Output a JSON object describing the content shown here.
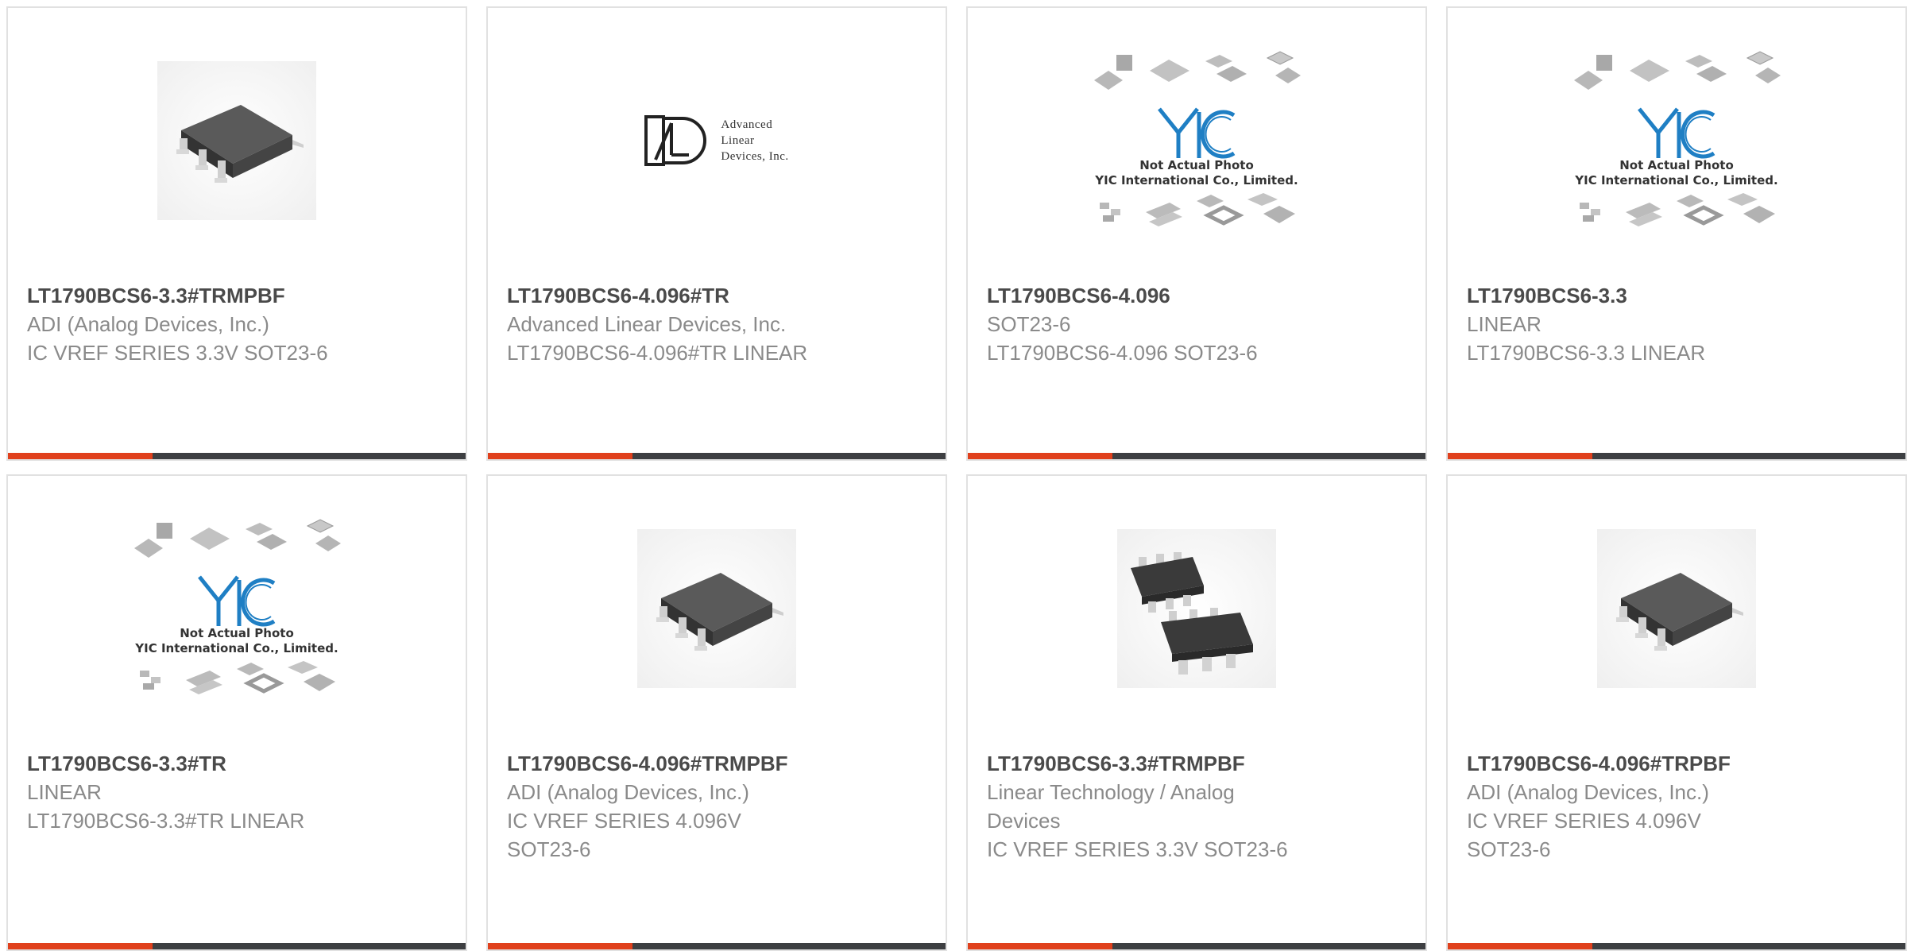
{
  "products": [
    {
      "part": "LT1790BCS6-3.3#TRMPBF",
      "lines": [
        "ADI (Analog Devices, Inc.)",
        "IC VREF SERIES 3.3V SOT23-6"
      ],
      "image": "sot23-chip"
    },
    {
      "part": "LT1790BCS6-4.096#TR",
      "lines": [
        "Advanced Linear Devices, Inc.",
        "LT1790BCS6-4.096#TR LINEAR"
      ],
      "image": "ald-logo"
    },
    {
      "part": "LT1790BCS6-4.096",
      "lines": [
        "SOT23-6",
        "LT1790BCS6-4.096 SOT23-6"
      ],
      "image": "yic-placeholder"
    },
    {
      "part": "LT1790BCS6-3.3",
      "lines": [
        "LINEAR",
        "LT1790BCS6-3.3 LINEAR"
      ],
      "image": "yic-placeholder"
    },
    {
      "part": "LT1790BCS6-3.3#TR",
      "lines": [
        "LINEAR",
        "LT1790BCS6-3.3#TR LINEAR"
      ],
      "image": "yic-placeholder"
    },
    {
      "part": "LT1790BCS6-4.096#TRMPBF",
      "lines": [
        "ADI (Analog Devices, Inc.)",
        "IC VREF SERIES 4.096V",
        "SOT23-6"
      ],
      "image": "sot23-chip"
    },
    {
      "part": "LT1790BCS6-3.3#TRMPBF",
      "lines": [
        "Linear Technology / Analog",
        "Devices",
        "IC VREF SERIES 3.3V SOT23-6"
      ],
      "image": "sot23-chip-pair"
    },
    {
      "part": "LT1790BCS6-4.096#TRPBF",
      "lines": [
        "ADI (Analog Devices, Inc.)",
        "IC VREF SERIES 4.096V",
        "SOT23-6"
      ],
      "image": "sot23-chip"
    }
  ],
  "logo": {
    "ald_lines": [
      "Advanced",
      "Linear",
      "Devices, Inc."
    ]
  },
  "placeholder": {
    "yic_caption_1": "Not Actual Photo",
    "yic_caption_2": "YIC International Co., Limited."
  },
  "colors": {
    "accent": "#e0401c",
    "bar": "#3d3f42",
    "part_text": "#4a4a4a",
    "meta_text": "#8a8a8a",
    "yic_blue": "#1f7fc4"
  }
}
